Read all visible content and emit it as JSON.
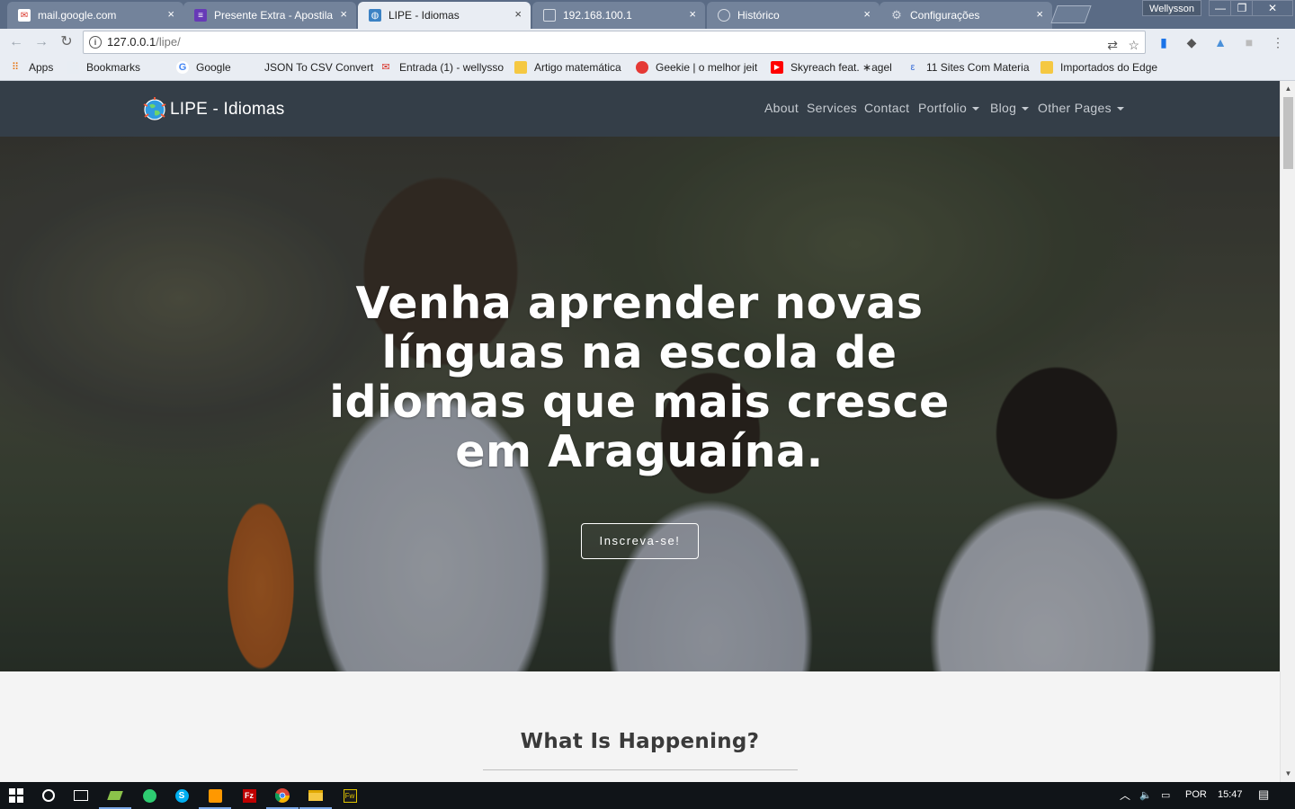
{
  "browser": {
    "tabs": [
      {
        "title": "mail.google.com",
        "icon": "mail-icon",
        "active": false
      },
      {
        "title": "Presente Extra - Apostila",
        "icon": "list-icon",
        "active": false
      },
      {
        "title": "LIPE - Idiomas",
        "icon": "globe-icon",
        "active": true
      },
      {
        "title": "192.168.100.1",
        "icon": "page-icon",
        "active": false
      },
      {
        "title": "Histórico",
        "icon": "history-icon",
        "active": false
      },
      {
        "title": "Configurações",
        "icon": "settings-icon",
        "active": false
      }
    ],
    "close_glyph": "×",
    "profile_name": "Wellysson",
    "window_controls": {
      "minimize": "—",
      "maximize": "❐",
      "close": "✕"
    },
    "address": {
      "host": "127.0.0.1",
      "path": "/lipe/"
    },
    "bookmarks": [
      {
        "label": "Apps",
        "icon": "apps-grid-icon"
      },
      {
        "label": "Bookmarks",
        "icon": "folder-icon"
      },
      {
        "label": "Google",
        "icon": "google-icon"
      },
      {
        "label": "JSON To CSV Convert",
        "icon": "json-icon"
      },
      {
        "label": "Entrada (1) - wellysso",
        "icon": "gmail-icon"
      },
      {
        "label": "Artigo matemática",
        "icon": "folder-icon"
      },
      {
        "label": "Geekie | o melhor jeit",
        "icon": "geekie-icon"
      },
      {
        "label": "Skyreach feat. ∗agel",
        "icon": "youtube-icon"
      },
      {
        "label": "11 Sites Com Materia",
        "icon": "site-icon"
      },
      {
        "label": "Importados do Edge",
        "icon": "folder-icon"
      }
    ]
  },
  "site": {
    "brand": "LIPE - Idiomas",
    "nav": [
      {
        "label": "About",
        "dropdown": false
      },
      {
        "label": "Services",
        "dropdown": false
      },
      {
        "label": "Contact",
        "dropdown": false
      },
      {
        "label": "Portfolio",
        "dropdown": true
      },
      {
        "label": "Blog",
        "dropdown": true
      },
      {
        "label": "Other Pages",
        "dropdown": true
      }
    ],
    "hero": {
      "title": "Venha aprender novas línguas na escola de idiomas que mais cresce em Araguaína.",
      "cta": "Inscreva-se!"
    },
    "section": {
      "title": "What Is Happening?"
    }
  },
  "taskbar": {
    "apps": [
      "windows-start-icon",
      "cortana-icon",
      "task-view-icon",
      "layers-app-icon",
      "whatsapp-icon",
      "skype-icon",
      "sublime-text-icon",
      "filezilla-icon",
      "chrome-icon",
      "file-explorer-icon",
      "fireworks-icon"
    ],
    "language": "POR",
    "time": "15:47"
  },
  "colors": {
    "tabbar": "#5a6b85",
    "site_nav": "#343e48",
    "page_bg": "#f4f4f4",
    "taskbar": "#101418"
  }
}
